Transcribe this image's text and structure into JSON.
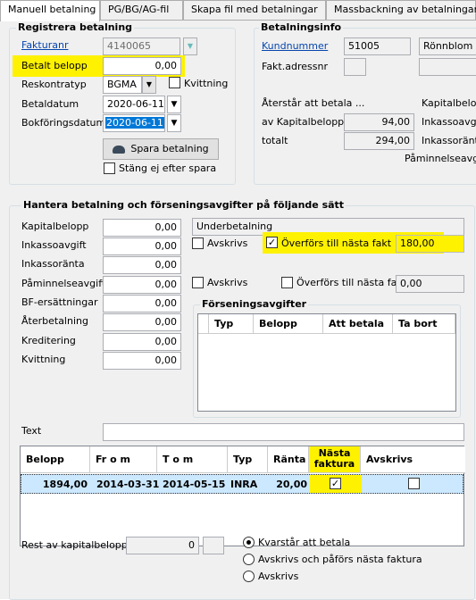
{
  "tabs": [
    "Manuell betalning",
    "PG/BG/AG-fil",
    "Skapa fil med betalningar",
    "Massbackning av betalningar"
  ],
  "register": {
    "title": "Registrera betalning",
    "fakturanr_label": "Fakturanr",
    "fakturanr": "4140065",
    "betalt_label": "Betalt belopp",
    "betalt": "0,00",
    "reskontra_label": "Reskontratyp",
    "reskontra": "BGMA",
    "kvittning_label": "Kvittning",
    "betaldatum_label": "Betaldatum",
    "betaldatum": "2020-06-11",
    "bokforing_label": "Bokföringsdatum",
    "bokforing": "2020-06-11",
    "save_label": "Spara betalning",
    "stang_label": "Stäng ej efter spara"
  },
  "info": {
    "title": "Betalningsinfo",
    "kundnummer_label": "Kundnummer",
    "kundnummer": "51005",
    "kundnamn": "Rönnblom Eli",
    "fakt_label": "Fakt.adressnr",
    "aterstar_label": "Återstår att betala ...",
    "kap_label": "av Kapitalbelopp",
    "kap": "94,00",
    "totalt_label": "totalt",
    "totalt": "294,00",
    "r1": "Kapitalbelop",
    "r2": "Inkassoavgi",
    "r3": "Inkassoränt",
    "r4": "Påminnelseavgi"
  },
  "hantera": {
    "title": "Hantera betalning och förseningsavgifter på följande sätt",
    "rows": [
      {
        "label": "Kapitalbelopp",
        "value": "0,00"
      },
      {
        "label": "Inkassoavgift",
        "value": "0,00"
      },
      {
        "label": "Inkassoränta",
        "value": "0,00"
      },
      {
        "label": "Påminnelseavgift",
        "value": "0,00"
      },
      {
        "label": "BF-ersättningar",
        "value": "0,00"
      },
      {
        "label": "Återbetalning",
        "value": "0,00"
      },
      {
        "label": "Kreditering",
        "value": "0,00"
      },
      {
        "label": "Kvittning",
        "value": "0,00"
      }
    ],
    "underbetalning": "Underbetalning",
    "avskrivs": "Avskrivs",
    "overfors": "Överförs till nästa fakt",
    "overfors_value": "180,00",
    "avskrivs2": "Avskrivs",
    "overfors2": "Överförs till nästa fakt",
    "overfors2_value": "0,00",
    "forsening_title": "Förseningsavgifter",
    "forsening_cols": [
      "Typ",
      "Belopp",
      "Att betala",
      "Ta bort"
    ],
    "text_label": "Text"
  },
  "grid": {
    "cols": [
      "Belopp",
      "Fr o m",
      "T o m",
      "Typ",
      "Ränta",
      "Nästa faktura",
      "Avskrivs"
    ],
    "row": {
      "belopp": "1894,00",
      "from": "2014-03-31",
      "tom": "2014-05-15",
      "typ": "INRA",
      "ranta": "20,00"
    }
  },
  "rest": {
    "label": "Rest av kapitalbelopp",
    "value": "0",
    "opt1": "Kvarstår att betala",
    "opt2": "Avskrivs och påförs nästa faktura",
    "opt3": "Avskrivs"
  },
  "colors": {
    "highlight": "#fff200",
    "selection": "#cce8ff",
    "date_sel": "#0078d7"
  }
}
